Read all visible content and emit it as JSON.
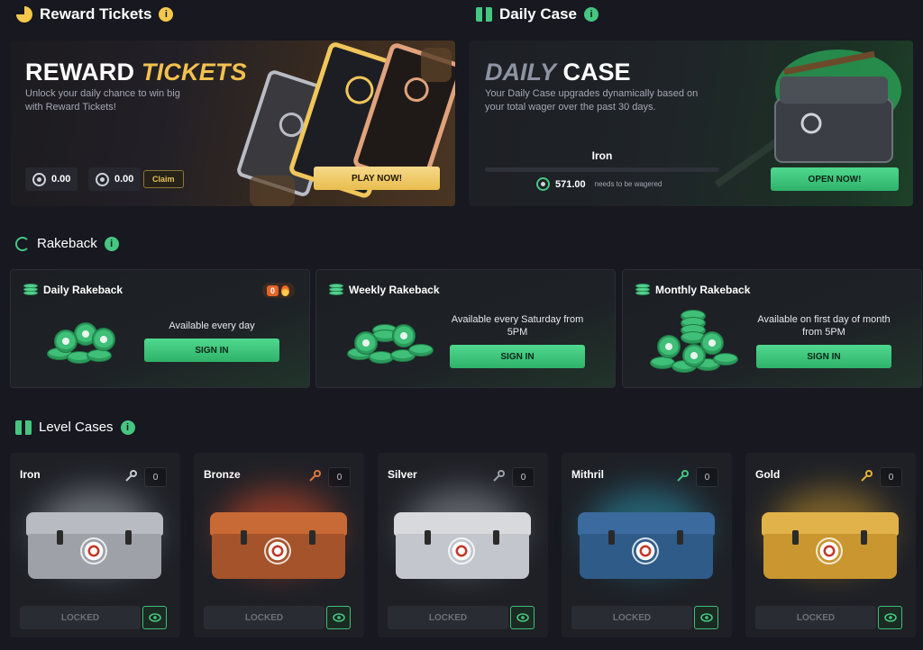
{
  "reward_tickets": {
    "heading": "Reward Tickets",
    "title_part1": "REWARD",
    "title_part2": "TICKETS",
    "description_line1": "Unlock your daily chance to win big",
    "description_line2": "with Reward Tickets!",
    "balance1": "0.00",
    "balance2": "0.00",
    "claim_label": "Claim",
    "play_label": "PLAY NOW!"
  },
  "daily_case": {
    "heading": "Daily Case",
    "title_part1": "DAILY",
    "title_part2": "CASE",
    "description_line1": "Your Daily Case upgrades dynamically based on",
    "description_line2": "your total wager over the past 30 days.",
    "tier": "Iron",
    "progress": 0,
    "wager_amount": "571.00",
    "wager_text": "needs to be wagered",
    "open_label": "OPEN NOW!"
  },
  "rakeback": {
    "heading": "Rakeback",
    "cards": [
      {
        "title": "Daily Rakeback",
        "desc_line1": "Available every day",
        "desc_line2": "",
        "button": "SIGN IN",
        "streak": "0"
      },
      {
        "title": "Weekly Rakeback",
        "desc_line1": "Available every Saturday from",
        "desc_line2": "5PM",
        "button": "SIGN IN"
      },
      {
        "title": "Monthly Rakeback",
        "desc_line1": "Available on first day of month",
        "desc_line2": "from 5PM",
        "button": "SIGN IN"
      }
    ]
  },
  "level_cases": {
    "heading": "Level Cases",
    "cases": [
      {
        "name": "Iron",
        "keys": "0",
        "button": "LOCKED",
        "key_color": "#c9ccd3",
        "glow": "#9aa0a8",
        "lid": "#b8bcc2",
        "body": "#9ea2a8"
      },
      {
        "name": "Bronze",
        "keys": "0",
        "button": "LOCKED",
        "key_color": "#d9793e",
        "glow": "#d04a2a",
        "lid": "#c86a35",
        "body": "#a4532a"
      },
      {
        "name": "Silver",
        "keys": "0",
        "button": "LOCKED",
        "key_color": "#9ea2a8",
        "glow": "#8c9099",
        "lid": "#d7d9dd",
        "body": "#c3c6cc"
      },
      {
        "name": "Mithril",
        "keys": "0",
        "button": "LOCKED",
        "key_color": "#45c781",
        "glow": "#2a8fa8",
        "lid": "#3a6a9e",
        "body": "#2f5b88"
      },
      {
        "name": "Gold",
        "keys": "0",
        "button": "LOCKED",
        "key_color": "#e7b33e",
        "glow": "#b88a2a",
        "lid": "#e2b24a",
        "body": "#c9962f"
      }
    ]
  },
  "colors": {
    "accent_green": "#45c781",
    "accent_gold": "#f2c14e",
    "background": "#171820"
  }
}
